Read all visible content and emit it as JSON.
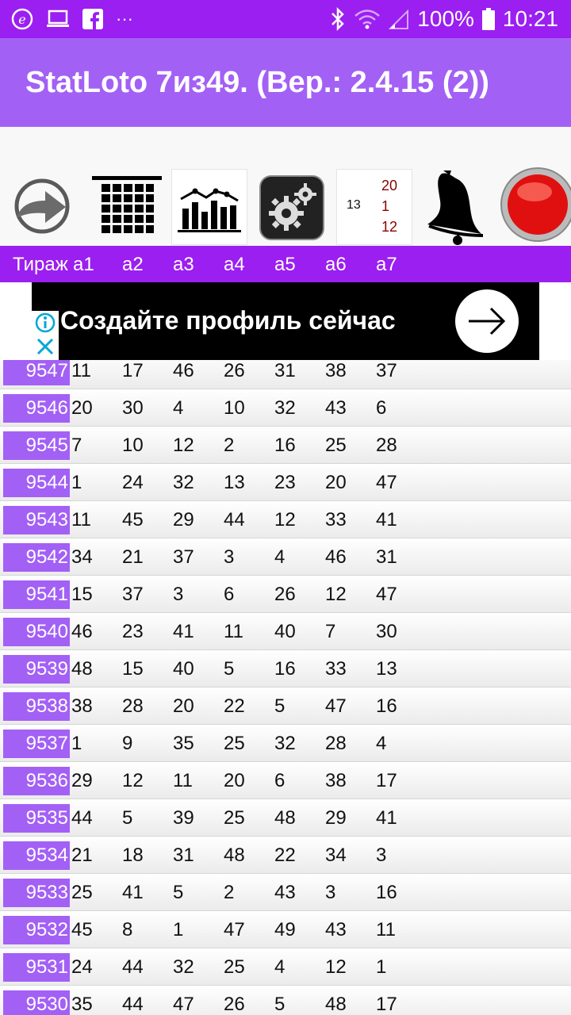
{
  "status_bar": {
    "battery": "100%",
    "time": "10:21",
    "more": "···"
  },
  "app": {
    "title": "StatLoto 7из49. (Вер.: 2.4.15 (2))"
  },
  "toolbar": {
    "calendar_numbers": [
      "20",
      "1",
      "12"
    ],
    "calendar_side": "13"
  },
  "table": {
    "headers": [
      "Тираж",
      "a1",
      "a2",
      "a3",
      "a4",
      "a5",
      "a6",
      "a7"
    ],
    "rows": [
      {
        "draw": "9547",
        "nums": [
          "11",
          "17",
          "46",
          "26",
          "31",
          "38",
          "37"
        ]
      },
      {
        "draw": "9546",
        "nums": [
          "20",
          "30",
          "4",
          "10",
          "32",
          "43",
          "6"
        ]
      },
      {
        "draw": "9545",
        "nums": [
          "7",
          "10",
          "12",
          "2",
          "16",
          "25",
          "28"
        ]
      },
      {
        "draw": "9544",
        "nums": [
          "1",
          "24",
          "32",
          "13",
          "23",
          "20",
          "47"
        ]
      },
      {
        "draw": "9543",
        "nums": [
          "11",
          "45",
          "29",
          "44",
          "12",
          "33",
          "41"
        ]
      },
      {
        "draw": "9542",
        "nums": [
          "34",
          "21",
          "37",
          "3",
          "4",
          "46",
          "31"
        ]
      },
      {
        "draw": "9541",
        "nums": [
          "15",
          "37",
          "3",
          "6",
          "26",
          "12",
          "47"
        ]
      },
      {
        "draw": "9540",
        "nums": [
          "46",
          "23",
          "41",
          "11",
          "40",
          "7",
          "30"
        ]
      },
      {
        "draw": "9539",
        "nums": [
          "48",
          "15",
          "40",
          "5",
          "16",
          "33",
          "13"
        ]
      },
      {
        "draw": "9538",
        "nums": [
          "38",
          "28",
          "20",
          "22",
          "5",
          "47",
          "16"
        ]
      },
      {
        "draw": "9537",
        "nums": [
          "1",
          "9",
          "35",
          "25",
          "32",
          "28",
          "4"
        ]
      },
      {
        "draw": "9536",
        "nums": [
          "29",
          "12",
          "11",
          "20",
          "6",
          "38",
          "17"
        ]
      },
      {
        "draw": "9535",
        "nums": [
          "44",
          "5",
          "39",
          "25",
          "48",
          "29",
          "41"
        ]
      },
      {
        "draw": "9534",
        "nums": [
          "21",
          "18",
          "31",
          "48",
          "22",
          "34",
          "3"
        ]
      },
      {
        "draw": "9533",
        "nums": [
          "25",
          "41",
          "5",
          "2",
          "43",
          "3",
          "16"
        ]
      },
      {
        "draw": "9532",
        "nums": [
          "45",
          "8",
          "1",
          "47",
          "49",
          "43",
          "11"
        ]
      },
      {
        "draw": "9531",
        "nums": [
          "24",
          "44",
          "32",
          "25",
          "4",
          "12",
          "1"
        ]
      },
      {
        "draw": "9530",
        "nums": [
          "35",
          "44",
          "47",
          "26",
          "5",
          "48",
          "17"
        ]
      }
    ]
  },
  "ad": {
    "text": "Создайте профиль сейчас"
  },
  "colors": {
    "status_bar": "#9b1ff0",
    "app_bar": "#a360f5",
    "draw_cell": "#a360f5"
  }
}
